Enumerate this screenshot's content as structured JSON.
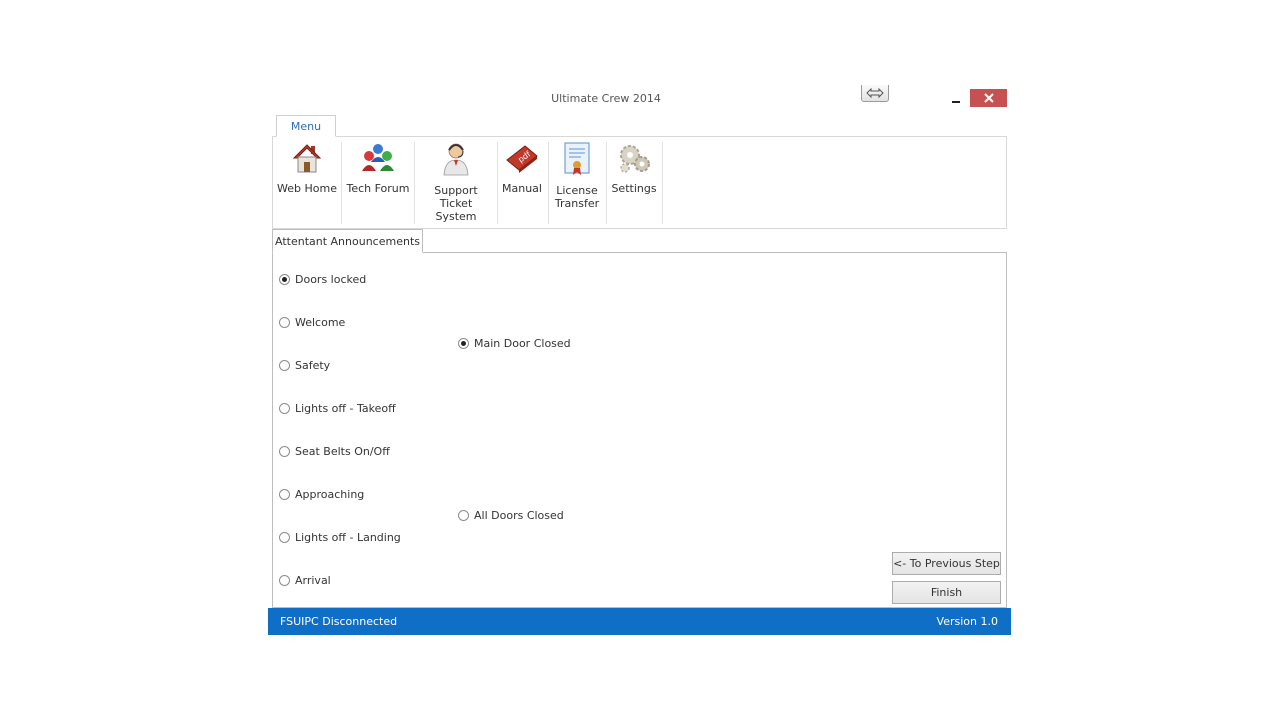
{
  "window": {
    "title": "Ultimate Crew 2014",
    "buttons": {
      "resize_icon": "double-arrow-icon",
      "minimize_icon": "minimize-icon",
      "close_icon": "close-icon"
    }
  },
  "ribbon": {
    "tab_label": "Menu",
    "items": [
      {
        "line1": "Web Home",
        "line2": "",
        "icon": "house-icon"
      },
      {
        "line1": "Tech Forum",
        "line2": "",
        "icon": "people-icon"
      },
      {
        "line1": "Support",
        "line2": "Ticket System",
        "icon": "support-agent-icon"
      },
      {
        "line1": "Manual",
        "line2": "",
        "icon": "pdf-icon"
      },
      {
        "line1": "License",
        "line2": "Transfer",
        "icon": "certificate-icon"
      },
      {
        "line1": "Settings",
        "line2": "",
        "icon": "gears-icon"
      }
    ]
  },
  "announcements": {
    "tab_label": "Attentant Announcements",
    "options": [
      {
        "label": "Doors locked",
        "checked": true
      },
      {
        "label": "Welcome",
        "checked": false
      },
      {
        "label": "Safety",
        "checked": false
      },
      {
        "label": "Lights off - Takeoff",
        "checked": false
      },
      {
        "label": "Seat Belts On/Off",
        "checked": false
      },
      {
        "label": "Approaching",
        "checked": false
      },
      {
        "label": "Lights off - Landing",
        "checked": false
      },
      {
        "label": "Arrival",
        "checked": false
      }
    ],
    "door_options": [
      {
        "label": "Main Door Closed",
        "checked": true
      },
      {
        "label": "All Doors Closed",
        "checked": false
      }
    ]
  },
  "actions": {
    "previous_label": "<- To Previous Step",
    "finish_label": "Finish"
  },
  "status": {
    "connection": "FSUIPC Disconnected",
    "version": "Version 1.0",
    "color": "#0f6fc6"
  },
  "colors": {
    "close": "#c75050",
    "accent": "#2b6fb6"
  }
}
